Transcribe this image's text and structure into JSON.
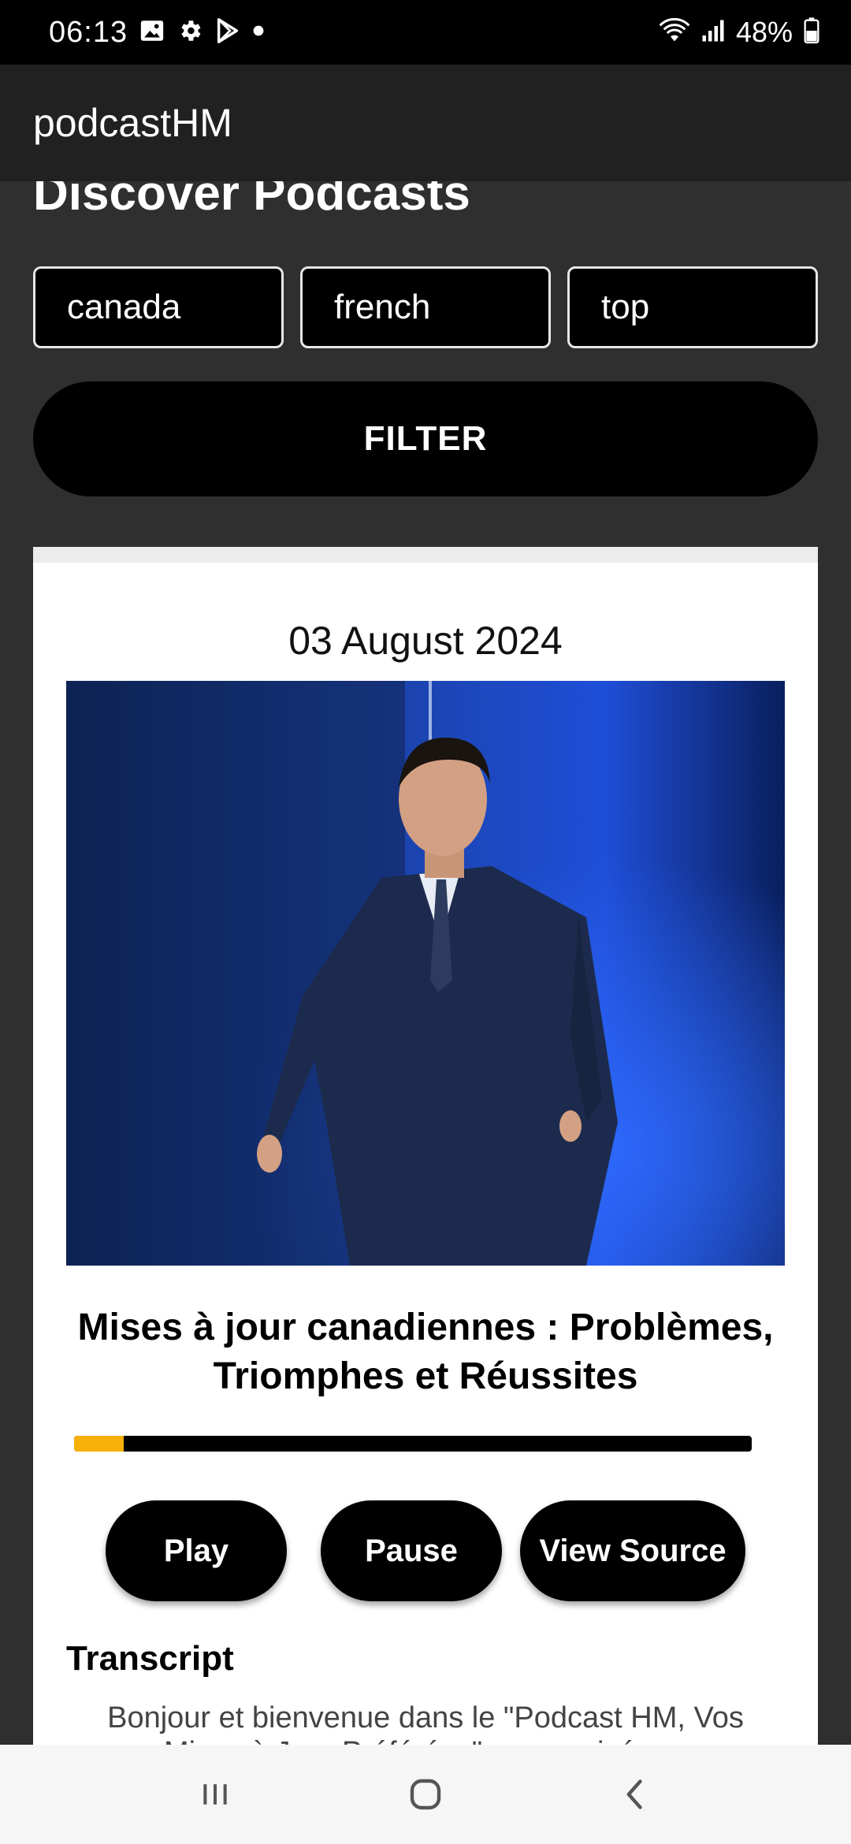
{
  "status_bar": {
    "time": "06:13",
    "battery_text": "48%",
    "icons": [
      "gallery-icon",
      "settings-icon",
      "play-store-icon",
      "dot-icon",
      "wifi-icon",
      "signal-icon",
      "battery-icon"
    ]
  },
  "app_bar": {
    "title": "podcastHM"
  },
  "discover": {
    "title": "Discover Podcasts",
    "filters": [
      {
        "value": "canada"
      },
      {
        "value": "french"
      },
      {
        "value": "top"
      }
    ],
    "filter_button": "FILTER"
  },
  "podcast_card": {
    "date": "03 August 2024",
    "image_icon": "podcast-cover-image",
    "title": "Mises à jour canadiennes : Problèmes, Triomphes et Réussites",
    "progress": 0.073,
    "progress_color": "#f5b10a",
    "buttons": {
      "play": "Play",
      "pause": "Pause",
      "view_source": "View Source"
    },
    "transcript_heading": "Transcript",
    "transcript_text": "Bonjour et bienvenue dans le \"Podcast HM, Vos Mises à Jour Préférées\" sponsorisé par"
  },
  "nav_bar": {
    "icons": [
      "recent-apps-icon",
      "home-icon",
      "back-icon"
    ]
  }
}
